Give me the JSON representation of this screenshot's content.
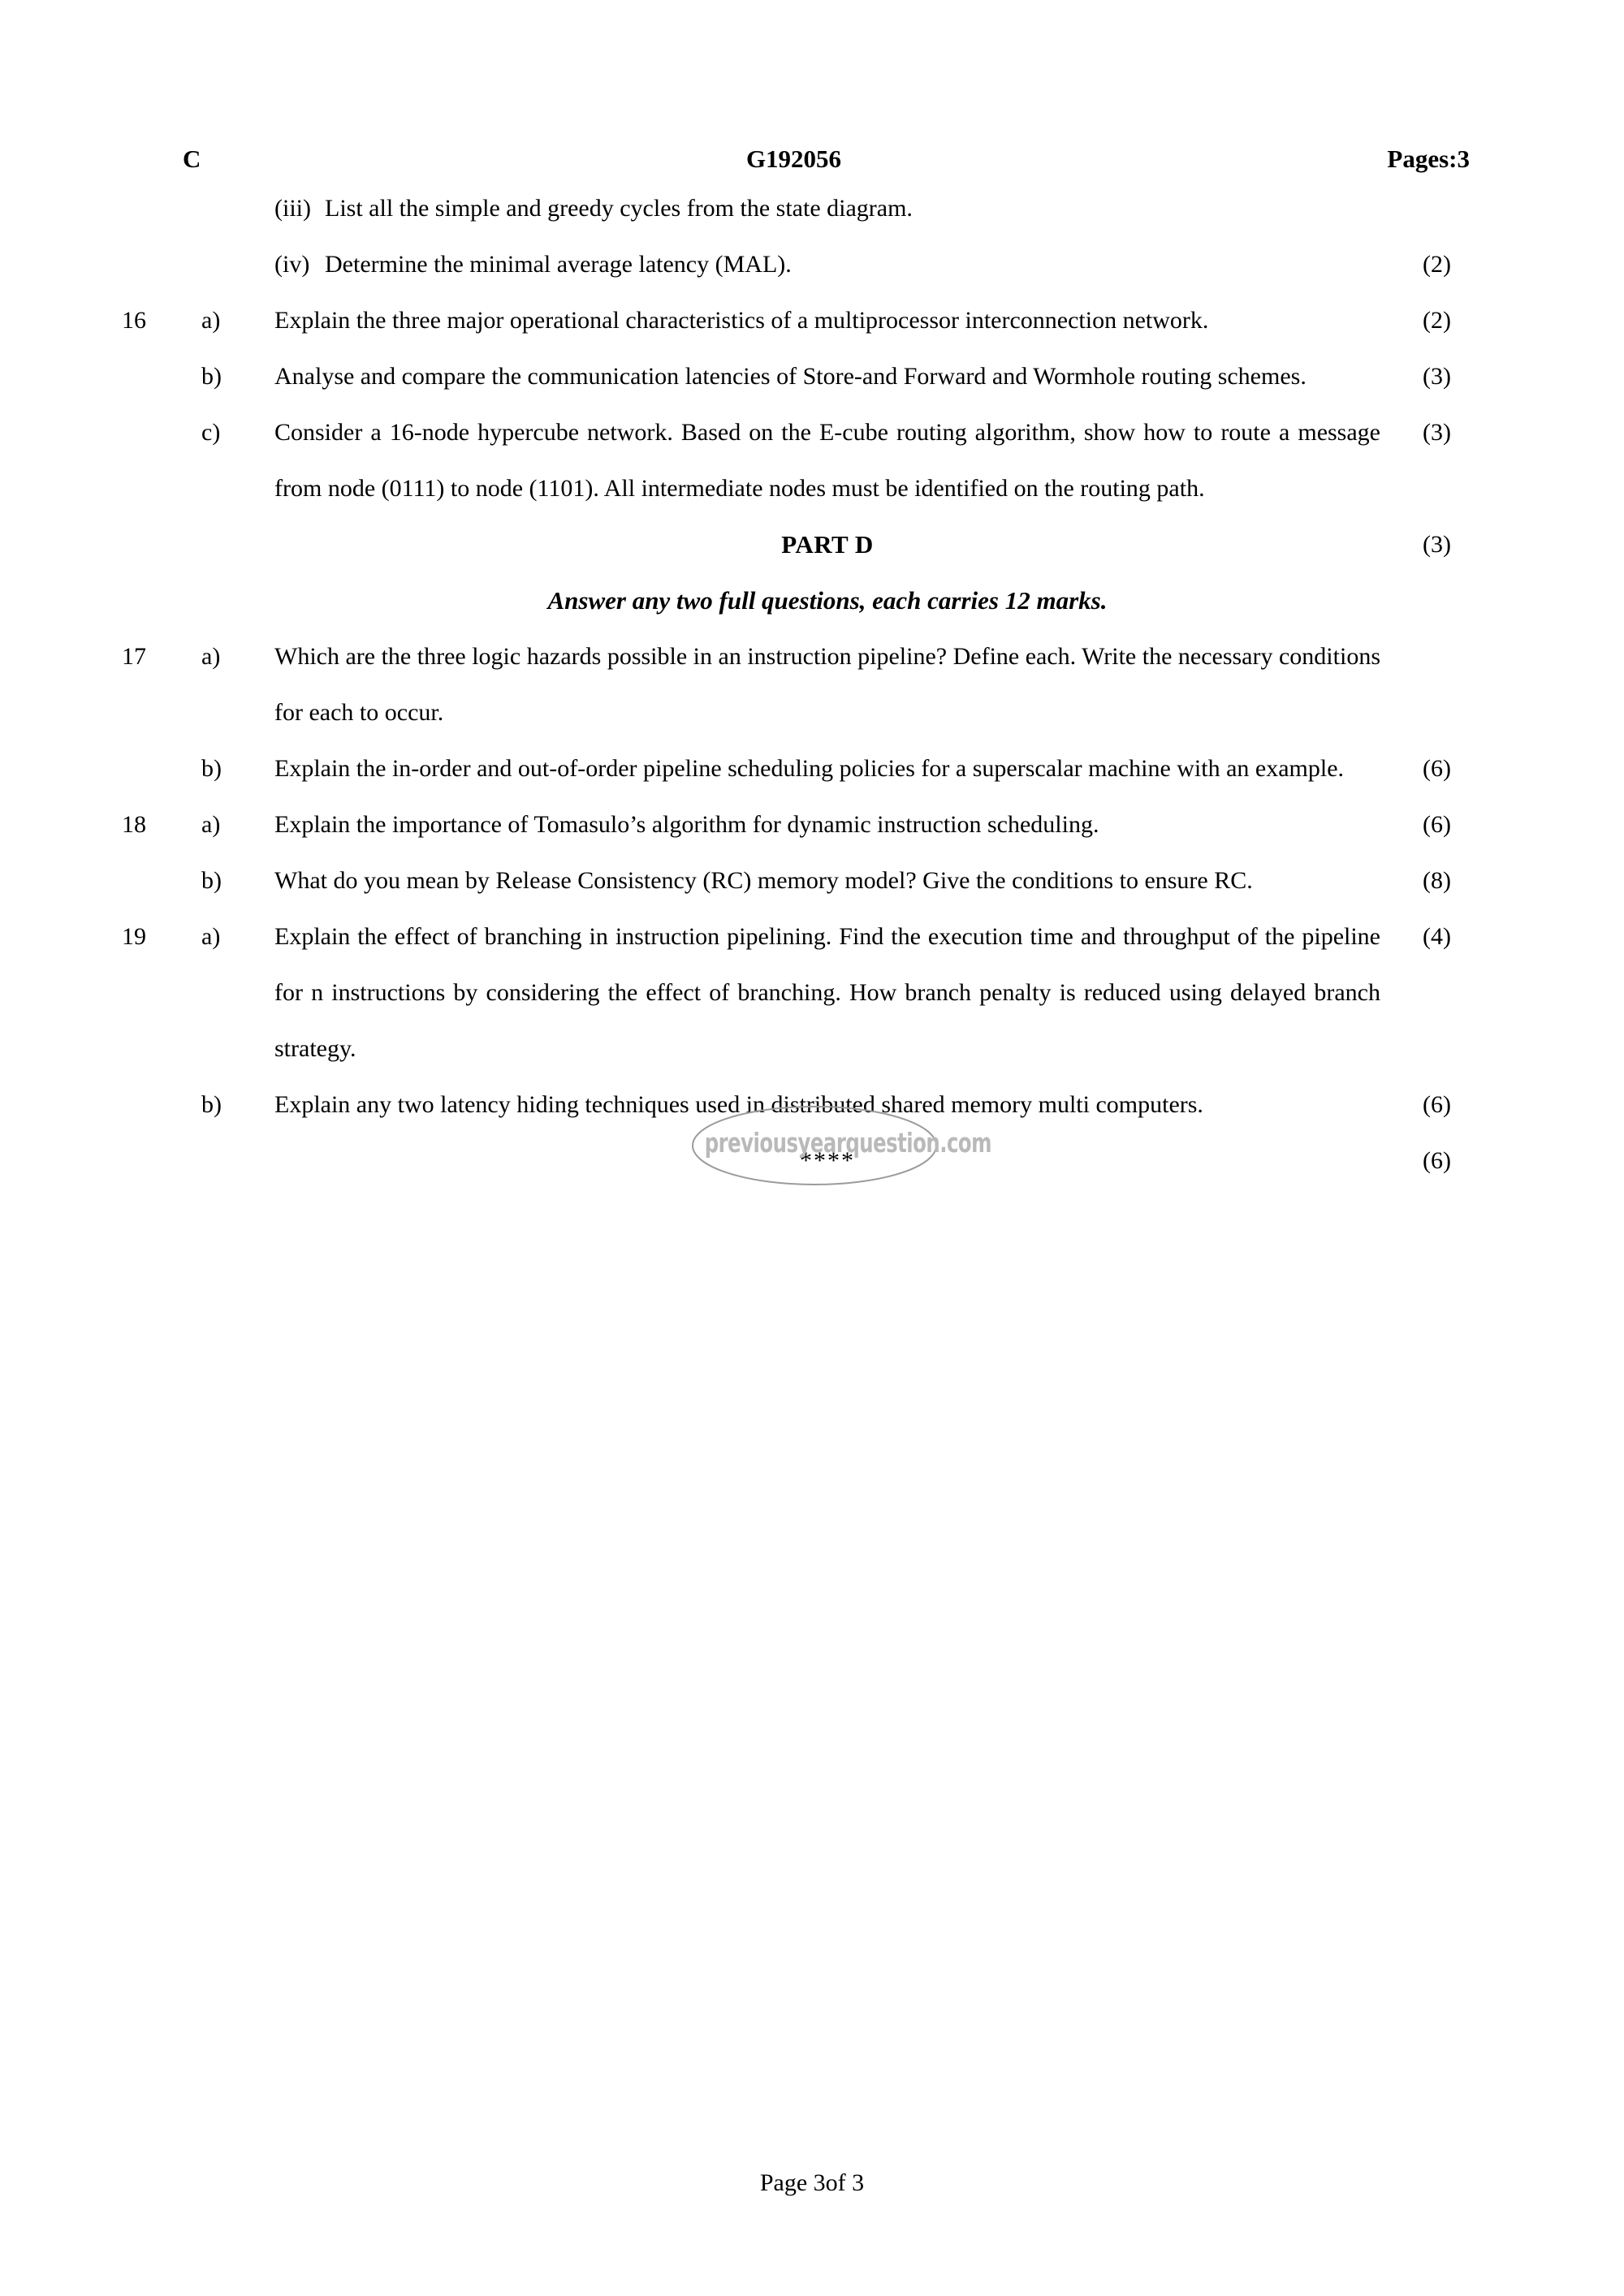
{
  "header": {
    "code_letter": "C",
    "paper_code": "G192056",
    "pages_label": "Pages:3"
  },
  "items": [
    {
      "kind": "roman",
      "label": "(iii)",
      "text": "List all the simple and greedy cycles from the state diagram.",
      "marks": "(2)"
    },
    {
      "kind": "roman",
      "label": "(iv)",
      "text": "Determine the minimal average latency (MAL).",
      "marks": "(2)"
    },
    {
      "kind": "question",
      "number": "16",
      "sub": "a)",
      "text": "Explain the three major operational characteristics of a multiprocessor interconnection network.",
      "marks": "(3)"
    },
    {
      "kind": "question",
      "number": "",
      "sub": "b)",
      "text": "Analyse and compare the communication latencies of Store-and Forward and Wormhole routing schemes.",
      "marks": "(3)"
    },
    {
      "kind": "question",
      "number": "",
      "sub": "c)",
      "text": "Consider a 16-node hypercube network. Based on the E-cube routing algorithm, show how to route a message from node (0111) to node (1101). All intermediate nodes must be identified on the routing path.",
      "marks": "(3)"
    },
    {
      "kind": "part-heading",
      "text": "PART D"
    },
    {
      "kind": "part-sub",
      "text": "Answer any two full questions, each carries 12 marks."
    },
    {
      "kind": "question",
      "number": "17",
      "sub": "a)",
      "text": "Which are the three logic hazards possible in an instruction pipeline? Define each. Write the necessary conditions for each to occur.",
      "marks": "(6)"
    },
    {
      "kind": "question",
      "number": "",
      "sub": "b)",
      "text": "Explain the in-order and out-of-order pipeline scheduling policies for a superscalar machine with an example.",
      "marks": "(6)"
    },
    {
      "kind": "question",
      "number": "18",
      "sub": "a)",
      "text": "Explain the importance of Tomasulo’s algorithm for dynamic instruction scheduling.",
      "marks": "(8)"
    },
    {
      "kind": "question",
      "number": "",
      "sub": "b)",
      "text": "What do you mean by Release Consistency (RC) memory model? Give the conditions to ensure RC.",
      "marks": "(4)"
    },
    {
      "kind": "question",
      "number": "19",
      "sub": "a)",
      "text": "Explain the effect of branching in instruction pipelining. Find the execution time and throughput of the pipeline for n instructions by considering the effect of branching. How branch penalty is reduced using delayed branch strategy.",
      "marks": "(6)"
    },
    {
      "kind": "question",
      "number": "",
      "sub": "b)",
      "text": "Explain any two latency hiding techniques used in distributed shared memory multi computers.",
      "marks": "(6)",
      "justify": false
    },
    {
      "kind": "end-mark",
      "text": "****"
    }
  ],
  "watermark": {
    "text": "previousyearquestion.com",
    "color": "#b9b9b9"
  },
  "footer": {
    "text": "Page 3of 3"
  }
}
